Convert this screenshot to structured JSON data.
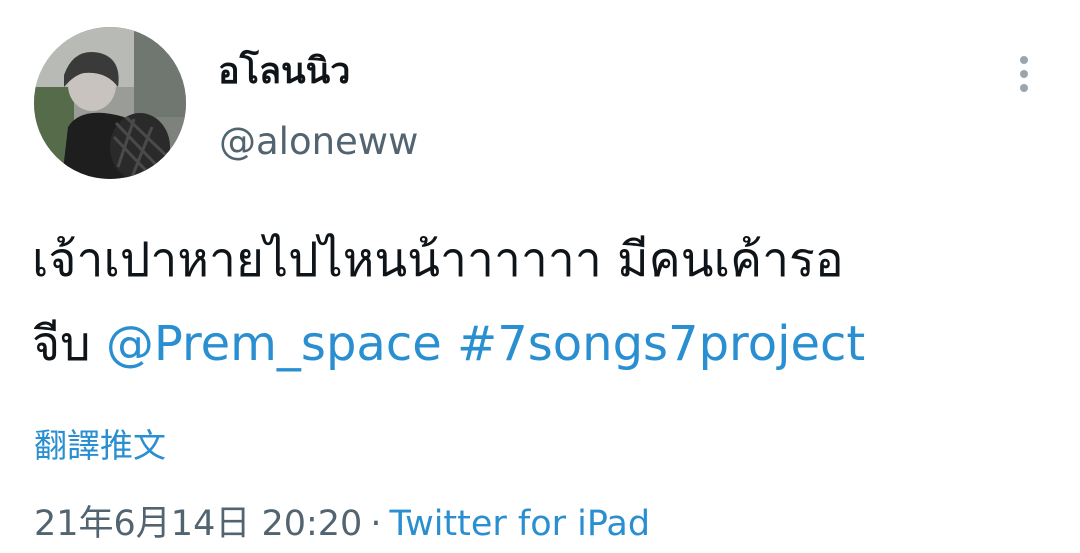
{
  "user": {
    "display_name": "อโลนนิว",
    "handle": "@aloneww",
    "avatar_icon": "profile-photo"
  },
  "tweet": {
    "text_line1": "เจ้าเปาหายไปไหนน้าาาาาา มีคนเค้ารอ",
    "text_line2_prefix": "จีบ ",
    "mention": "@Prem_space",
    "hashtag": "#7songs7project",
    "translate_label": "翻譯推文",
    "timestamp": "21年6月14日 20:20",
    "separator": "·",
    "source": "Twitter for iPad"
  },
  "menu": {
    "icon": "more-vertical-icon"
  },
  "colors": {
    "link": "#2a8fd0",
    "secondary_text": "#536471",
    "primary_text": "#0f1419"
  }
}
